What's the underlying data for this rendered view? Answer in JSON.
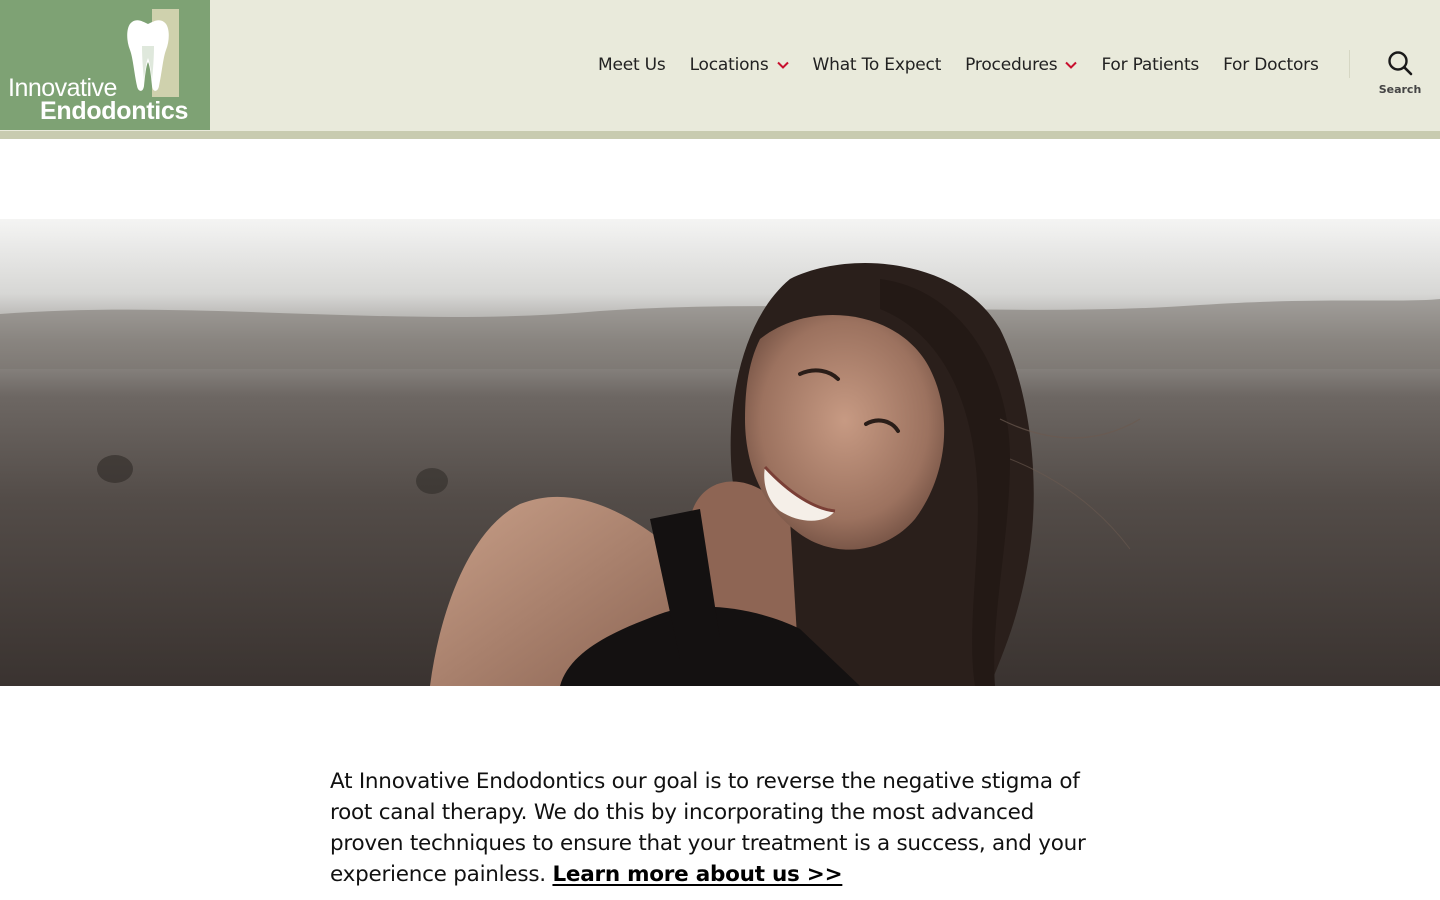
{
  "logo": {
    "line1": "Innovative",
    "line2": "Endodontics",
    "background": "#7ea274",
    "icon": "tooth-icon"
  },
  "nav": {
    "items": [
      {
        "label": "Meet Us",
        "dropdown": false
      },
      {
        "label": "Locations",
        "dropdown": true
      },
      {
        "label": "What To Expect",
        "dropdown": false
      },
      {
        "label": "Procedures",
        "dropdown": true
      },
      {
        "label": "For Patients",
        "dropdown": false
      },
      {
        "label": "For Doctors",
        "dropdown": false
      }
    ],
    "chevron_color": "#c8102e",
    "search_label": "Search"
  },
  "header": {
    "background": "#e9eadb",
    "rule_color": "#c8cbb0"
  },
  "hero": {
    "image": "smiling-woman-photo"
  },
  "intro": {
    "text": "At Innovative Endodontics our goal is to reverse the negative stigma of root canal therapy. We do this by incorporating the most advanced proven techniques to ensure that your treatment is a success, and your experience painless.",
    "link_label": "Learn more about us >>"
  }
}
